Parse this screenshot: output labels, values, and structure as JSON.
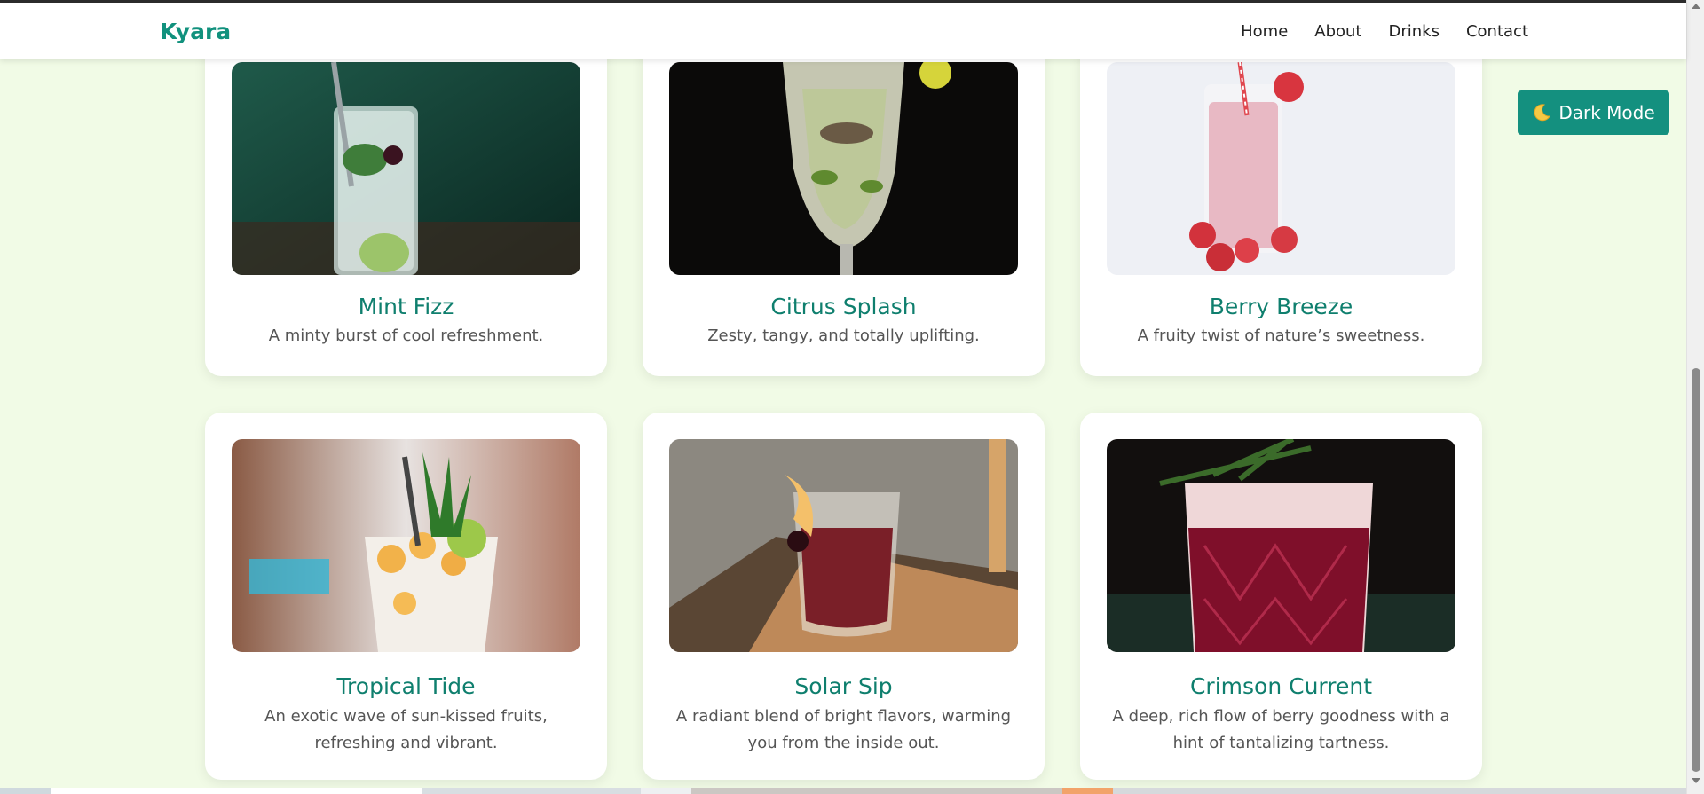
{
  "navbar": {
    "brand": "Kyara",
    "links": [
      "Home",
      "About",
      "Drinks",
      "Contact"
    ]
  },
  "dark_mode": {
    "label": "Dark Mode",
    "icon": "moon-icon"
  },
  "drinks": [
    {
      "title": "Mint Fizz",
      "description": "A minty burst of cool refreshment.",
      "image": "mint-fizz-drink-image"
    },
    {
      "title": "Citrus Splash",
      "description": "Zesty, tangy, and totally uplifting.",
      "image": "citrus-splash-drink-image"
    },
    {
      "title": "Berry Breeze",
      "description": "A fruity twist of nature’s sweetness.",
      "image": "berry-breeze-drink-image"
    },
    {
      "title": "Tropical Tide",
      "description": "An exotic wave of sun-kissed fruits, refreshing and vibrant.",
      "image": "tropical-tide-drink-image"
    },
    {
      "title": "Solar Sip",
      "description": "A radiant blend of bright flavors, warming you from the inside out.",
      "image": "solar-sip-drink-image"
    },
    {
      "title": "Crimson Current",
      "description": "A deep, rich flow of berry goodness with a hint of tantalizing tartness.",
      "image": "crimson-current-drink-image"
    }
  ],
  "colors": {
    "background": "#f1fbe6",
    "accent": "#11917d",
    "card_title": "#0f7f6e"
  }
}
